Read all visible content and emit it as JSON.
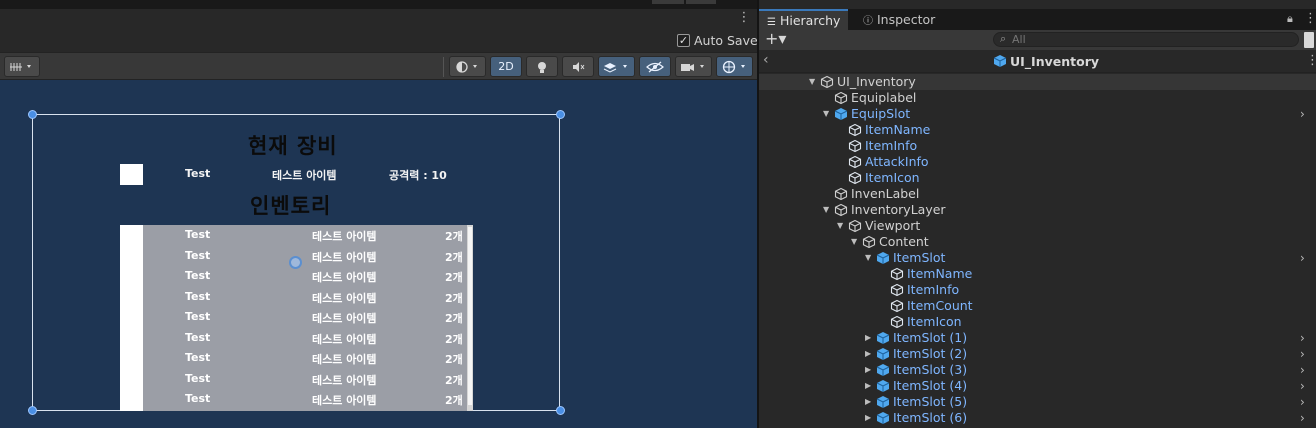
{
  "scene": {
    "menu_icon": "more-vertical-icon",
    "autosave_label": "Auto Save",
    "autosave_checked": true,
    "toolbar": {
      "grid_icon": "grid-snap-icon",
      "shading_icon": "shading-mode-icon",
      "mode_2d_label": "2D",
      "lighting_icon": "lighting-icon",
      "audio_icon": "audio-mute-icon",
      "effects_icon": "effects-layers-icon",
      "visibility_icon": "scene-visibility-icon",
      "camera_icon": "camera-icon",
      "gizmos_icon": "gizmos-globe-icon"
    },
    "canvas": {
      "equip_title": "현재 장비",
      "equip_name": "Test",
      "equip_info": "테스트 아이템",
      "equip_attack": "공격력 : 10",
      "inventory_title": "인벤토리",
      "inventory_rows": [
        {
          "name": "Test",
          "info": "테스트 아이템",
          "count": "2개"
        },
        {
          "name": "Test",
          "info": "테스트 아이템",
          "count": "2개"
        },
        {
          "name": "Test",
          "info": "테스트 아이템",
          "count": "2개"
        },
        {
          "name": "Test",
          "info": "테스트 아이템",
          "count": "2개"
        },
        {
          "name": "Test",
          "info": "테스트 아이템",
          "count": "2개"
        },
        {
          "name": "Test",
          "info": "테스트 아이템",
          "count": "2개"
        },
        {
          "name": "Test",
          "info": "테스트 아이템",
          "count": "2개"
        },
        {
          "name": "Test",
          "info": "테스트 아이템",
          "count": "2개"
        },
        {
          "name": "Test",
          "info": "테스트 아이템",
          "count": "2개"
        }
      ]
    }
  },
  "hierarchy": {
    "tabs": {
      "hierarchy_label": "Hierarchy",
      "inspector_label": "Inspector"
    },
    "add_label": "+▾",
    "search_placeholder": "All",
    "prefab_title": "UI_Inventory",
    "tree": [
      {
        "label": "UI_Inventory",
        "depth": 0,
        "arrow": "down",
        "prefab": false,
        "selected": true
      },
      {
        "label": "Equiplabel",
        "depth": 1,
        "arrow": "",
        "prefab": false
      },
      {
        "label": "EquipSlot",
        "depth": 1,
        "arrow": "down",
        "prefab": true,
        "chevron": true
      },
      {
        "label": "ItemName",
        "depth": 2,
        "arrow": "",
        "prefab": true
      },
      {
        "label": "ItemInfo",
        "depth": 2,
        "arrow": "",
        "prefab": true
      },
      {
        "label": "AttackInfo",
        "depth": 2,
        "arrow": "",
        "prefab": true
      },
      {
        "label": "ItemIcon",
        "depth": 2,
        "arrow": "",
        "prefab": true
      },
      {
        "label": "InvenLabel",
        "depth": 1,
        "arrow": "",
        "prefab": false
      },
      {
        "label": "InventoryLayer",
        "depth": 1,
        "arrow": "down",
        "prefab": false
      },
      {
        "label": "Viewport",
        "depth": 2,
        "arrow": "down",
        "prefab": false
      },
      {
        "label": "Content",
        "depth": 3,
        "arrow": "down",
        "prefab": false
      },
      {
        "label": "ItemSlot",
        "depth": 4,
        "arrow": "down",
        "prefab": true,
        "chevron": true
      },
      {
        "label": "ItemName",
        "depth": 5,
        "arrow": "",
        "prefab": true
      },
      {
        "label": "ItemInfo",
        "depth": 5,
        "arrow": "",
        "prefab": true
      },
      {
        "label": "ItemCount",
        "depth": 5,
        "arrow": "",
        "prefab": true
      },
      {
        "label": "ItemIcon",
        "depth": 5,
        "arrow": "",
        "prefab": true
      },
      {
        "label": "ItemSlot (1)",
        "depth": 4,
        "arrow": "right",
        "prefab": true,
        "chevron": true
      },
      {
        "label": "ItemSlot (2)",
        "depth": 4,
        "arrow": "right",
        "prefab": true,
        "chevron": true
      },
      {
        "label": "ItemSlot (3)",
        "depth": 4,
        "arrow": "right",
        "prefab": true,
        "chevron": true
      },
      {
        "label": "ItemSlot (4)",
        "depth": 4,
        "arrow": "right",
        "prefab": true,
        "chevron": true
      },
      {
        "label": "ItemSlot (5)",
        "depth": 4,
        "arrow": "right",
        "prefab": true,
        "chevron": true
      },
      {
        "label": "ItemSlot (6)",
        "depth": 4,
        "arrow": "right",
        "prefab": true,
        "chevron": true
      }
    ]
  },
  "colors": {
    "scene_background": "#1e3553",
    "prefab_text": "#7fb6ff",
    "selection_handle": "#4a8fe4",
    "inventory_content": "#9b9ea6"
  }
}
